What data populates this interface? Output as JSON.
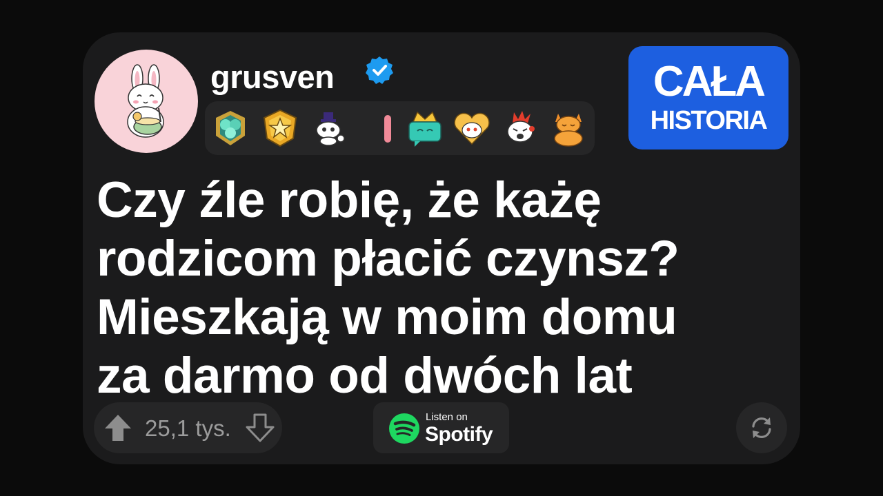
{
  "post": {
    "username": "grusven",
    "title_lines": [
      "Czy źle robię, że każę",
      "rodzicom płacić czynsz?",
      "Mieszkają w moim domu",
      "za darmo od dwóch lat"
    ],
    "vote_count": "25,1 tys."
  },
  "story_button": {
    "line1": "CAŁA",
    "line2": "HISTORIA"
  },
  "spotify": {
    "small_text": "Listen on",
    "brand": "Spotify"
  },
  "icons": {
    "avatar": "bunny-avatar-icon",
    "verified": "verified-check-icon",
    "badges": [
      "gem-trophy-badge",
      "star-shield-badge",
      "snoo-hat-badge",
      "pink-pill-badge",
      "crown-chat-badge",
      "heart-snoo-badge",
      "fire-snoo-badge",
      "meditating-cat-badge"
    ],
    "upvote": "upvote-arrow-icon",
    "downvote": "downvote-arrow-icon",
    "spotify": "spotify-logo-icon",
    "share": "refresh-arrows-icon"
  },
  "colors": {
    "background": "#0b0b0b",
    "card": "#1b1b1c",
    "story_button": "#1d5fe0",
    "verified": "#1d9bf0",
    "spotify": "#1ed760"
  }
}
